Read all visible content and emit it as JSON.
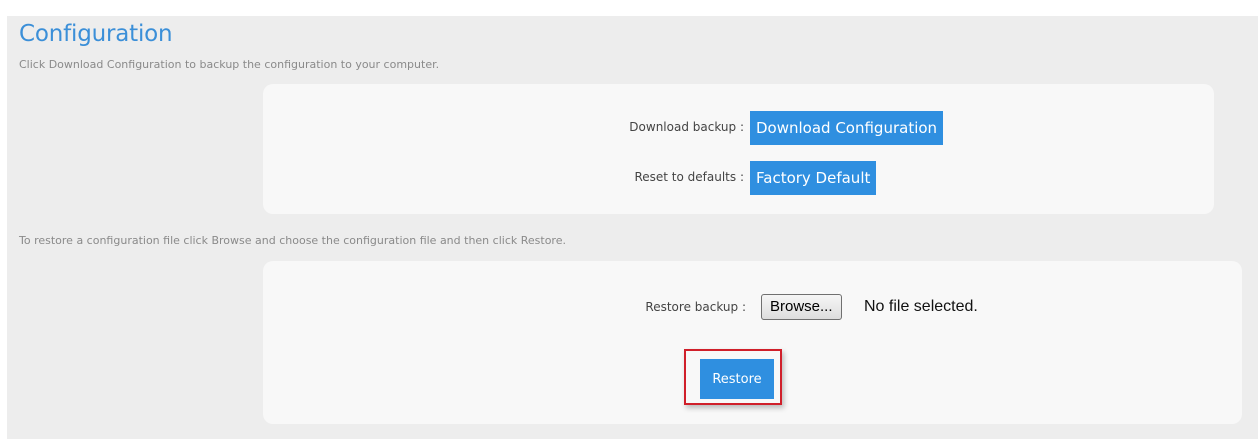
{
  "header": {
    "title": "Configuration",
    "subtitle": "Click Download Configuration to backup the configuration to your computer."
  },
  "backup_panel": {
    "download_label": "Download backup :",
    "download_button": "Download Configuration",
    "reset_label": "Reset to defaults :",
    "reset_button": "Factory Default"
  },
  "restore_instructions": "To restore a configuration file click Browse and choose the configuration file and then click Restore.",
  "restore_panel": {
    "restore_label": "Restore backup :",
    "browse_button": "Browse...",
    "file_status": "No file selected.",
    "restore_button": "Restore"
  },
  "colors": {
    "accent": "#2f8fe0",
    "title": "#3b8fd8",
    "highlight": "#d01f2a"
  }
}
